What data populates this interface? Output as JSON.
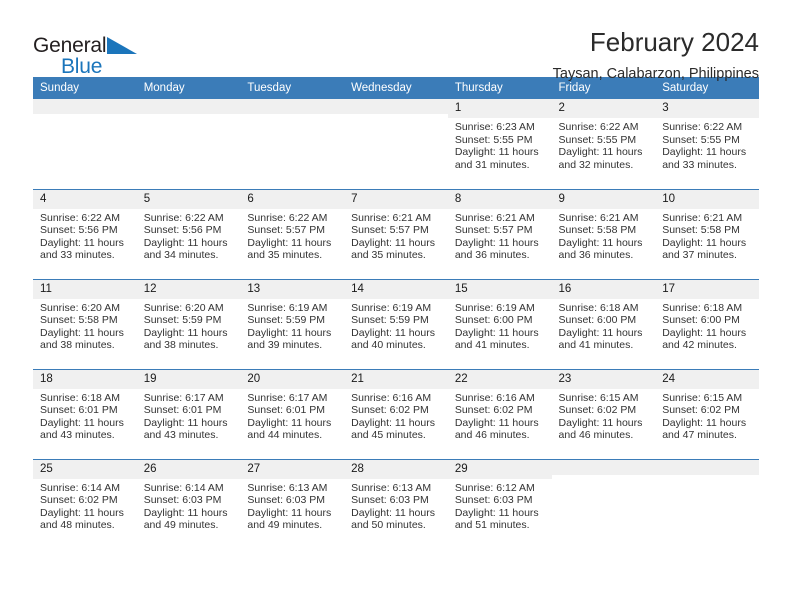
{
  "logo": {
    "word1": "General",
    "word2": "Blue",
    "icon": "blue-triangle",
    "accent_color": "#1b75bb"
  },
  "header": {
    "title": "February 2024",
    "subtitle": "Taysan, Calabarzon, Philippines"
  },
  "theme": {
    "header_bg": "#3b7cb8",
    "header_text": "#ffffff",
    "daynum_bg": "#f0f0f0",
    "grid_line": "#3b7cb8"
  },
  "weekdays": [
    "Sunday",
    "Monday",
    "Tuesday",
    "Wednesday",
    "Thursday",
    "Friday",
    "Saturday"
  ],
  "labels": {
    "sunrise_prefix": "Sunrise: ",
    "sunset_prefix": "Sunset: ",
    "daylight_prefix": "Daylight: "
  },
  "weeks": [
    [
      {
        "day": "",
        "blank": true
      },
      {
        "day": "",
        "blank": true
      },
      {
        "day": "",
        "blank": true
      },
      {
        "day": "",
        "blank": true
      },
      {
        "day": "1",
        "sunrise": "Sunrise: 6:23 AM",
        "sunset": "Sunset: 5:55 PM",
        "daylight": "Daylight: 11 hours and 31 minutes."
      },
      {
        "day": "2",
        "sunrise": "Sunrise: 6:22 AM",
        "sunset": "Sunset: 5:55 PM",
        "daylight": "Daylight: 11 hours and 32 minutes."
      },
      {
        "day": "3",
        "sunrise": "Sunrise: 6:22 AM",
        "sunset": "Sunset: 5:55 PM",
        "daylight": "Daylight: 11 hours and 33 minutes."
      }
    ],
    [
      {
        "day": "4",
        "sunrise": "Sunrise: 6:22 AM",
        "sunset": "Sunset: 5:56 PM",
        "daylight": "Daylight: 11 hours and 33 minutes."
      },
      {
        "day": "5",
        "sunrise": "Sunrise: 6:22 AM",
        "sunset": "Sunset: 5:56 PM",
        "daylight": "Daylight: 11 hours and 34 minutes."
      },
      {
        "day": "6",
        "sunrise": "Sunrise: 6:22 AM",
        "sunset": "Sunset: 5:57 PM",
        "daylight": "Daylight: 11 hours and 35 minutes."
      },
      {
        "day": "7",
        "sunrise": "Sunrise: 6:21 AM",
        "sunset": "Sunset: 5:57 PM",
        "daylight": "Daylight: 11 hours and 35 minutes."
      },
      {
        "day": "8",
        "sunrise": "Sunrise: 6:21 AM",
        "sunset": "Sunset: 5:57 PM",
        "daylight": "Daylight: 11 hours and 36 minutes."
      },
      {
        "day": "9",
        "sunrise": "Sunrise: 6:21 AM",
        "sunset": "Sunset: 5:58 PM",
        "daylight": "Daylight: 11 hours and 36 minutes."
      },
      {
        "day": "10",
        "sunrise": "Sunrise: 6:21 AM",
        "sunset": "Sunset: 5:58 PM",
        "daylight": "Daylight: 11 hours and 37 minutes."
      }
    ],
    [
      {
        "day": "11",
        "sunrise": "Sunrise: 6:20 AM",
        "sunset": "Sunset: 5:58 PM",
        "daylight": "Daylight: 11 hours and 38 minutes."
      },
      {
        "day": "12",
        "sunrise": "Sunrise: 6:20 AM",
        "sunset": "Sunset: 5:59 PM",
        "daylight": "Daylight: 11 hours and 38 minutes."
      },
      {
        "day": "13",
        "sunrise": "Sunrise: 6:19 AM",
        "sunset": "Sunset: 5:59 PM",
        "daylight": "Daylight: 11 hours and 39 minutes."
      },
      {
        "day": "14",
        "sunrise": "Sunrise: 6:19 AM",
        "sunset": "Sunset: 5:59 PM",
        "daylight": "Daylight: 11 hours and 40 minutes."
      },
      {
        "day": "15",
        "sunrise": "Sunrise: 6:19 AM",
        "sunset": "Sunset: 6:00 PM",
        "daylight": "Daylight: 11 hours and 41 minutes."
      },
      {
        "day": "16",
        "sunrise": "Sunrise: 6:18 AM",
        "sunset": "Sunset: 6:00 PM",
        "daylight": "Daylight: 11 hours and 41 minutes."
      },
      {
        "day": "17",
        "sunrise": "Sunrise: 6:18 AM",
        "sunset": "Sunset: 6:00 PM",
        "daylight": "Daylight: 11 hours and 42 minutes."
      }
    ],
    [
      {
        "day": "18",
        "sunrise": "Sunrise: 6:18 AM",
        "sunset": "Sunset: 6:01 PM",
        "daylight": "Daylight: 11 hours and 43 minutes."
      },
      {
        "day": "19",
        "sunrise": "Sunrise: 6:17 AM",
        "sunset": "Sunset: 6:01 PM",
        "daylight": "Daylight: 11 hours and 43 minutes."
      },
      {
        "day": "20",
        "sunrise": "Sunrise: 6:17 AM",
        "sunset": "Sunset: 6:01 PM",
        "daylight": "Daylight: 11 hours and 44 minutes."
      },
      {
        "day": "21",
        "sunrise": "Sunrise: 6:16 AM",
        "sunset": "Sunset: 6:02 PM",
        "daylight": "Daylight: 11 hours and 45 minutes."
      },
      {
        "day": "22",
        "sunrise": "Sunrise: 6:16 AM",
        "sunset": "Sunset: 6:02 PM",
        "daylight": "Daylight: 11 hours and 46 minutes."
      },
      {
        "day": "23",
        "sunrise": "Sunrise: 6:15 AM",
        "sunset": "Sunset: 6:02 PM",
        "daylight": "Daylight: 11 hours and 46 minutes."
      },
      {
        "day": "24",
        "sunrise": "Sunrise: 6:15 AM",
        "sunset": "Sunset: 6:02 PM",
        "daylight": "Daylight: 11 hours and 47 minutes."
      }
    ],
    [
      {
        "day": "25",
        "sunrise": "Sunrise: 6:14 AM",
        "sunset": "Sunset: 6:02 PM",
        "daylight": "Daylight: 11 hours and 48 minutes."
      },
      {
        "day": "26",
        "sunrise": "Sunrise: 6:14 AM",
        "sunset": "Sunset: 6:03 PM",
        "daylight": "Daylight: 11 hours and 49 minutes."
      },
      {
        "day": "27",
        "sunrise": "Sunrise: 6:13 AM",
        "sunset": "Sunset: 6:03 PM",
        "daylight": "Daylight: 11 hours and 49 minutes."
      },
      {
        "day": "28",
        "sunrise": "Sunrise: 6:13 AM",
        "sunset": "Sunset: 6:03 PM",
        "daylight": "Daylight: 11 hours and 50 minutes."
      },
      {
        "day": "29",
        "sunrise": "Sunrise: 6:12 AM",
        "sunset": "Sunset: 6:03 PM",
        "daylight": "Daylight: 11 hours and 51 minutes."
      },
      {
        "day": "",
        "blank": true
      },
      {
        "day": "",
        "blank": true
      }
    ]
  ]
}
